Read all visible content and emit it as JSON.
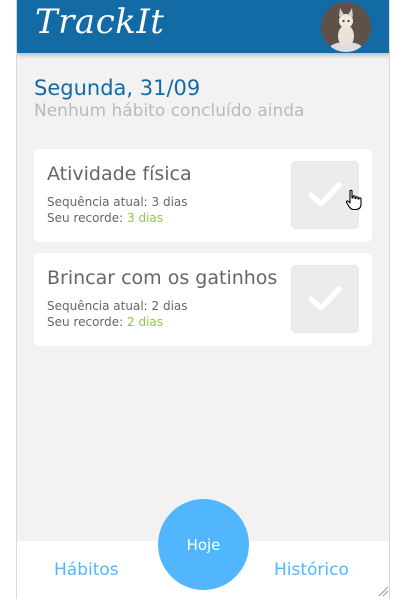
{
  "header": {
    "app_name": "TrackIt",
    "avatar_icon": "cat-avatar"
  },
  "today": {
    "date_label": "Segunda, 31/09",
    "progress_text": "Nenhum hábito concluído ainda"
  },
  "habits": [
    {
      "name": "Atividade física",
      "streak_label": "Sequência atual: ",
      "streak_value": "3 dias",
      "record_label": "Seu recorde: ",
      "record_value": "3 dias",
      "done": false
    },
    {
      "name": "Brincar com os gatinhos",
      "streak_label": "Sequência atual: ",
      "streak_value": "2 dias",
      "record_label": "Seu recorde: ",
      "record_value": "2 dias",
      "done": false
    }
  ],
  "footer": {
    "habits_link": "Hábitos",
    "today_button": "Hoje",
    "history_link": "Histórico"
  },
  "colors": {
    "header_bg": "#126ba5",
    "accent_blue": "#52b6ff",
    "record_green": "#8fc549",
    "check_box_bg": "#ebebeb"
  }
}
